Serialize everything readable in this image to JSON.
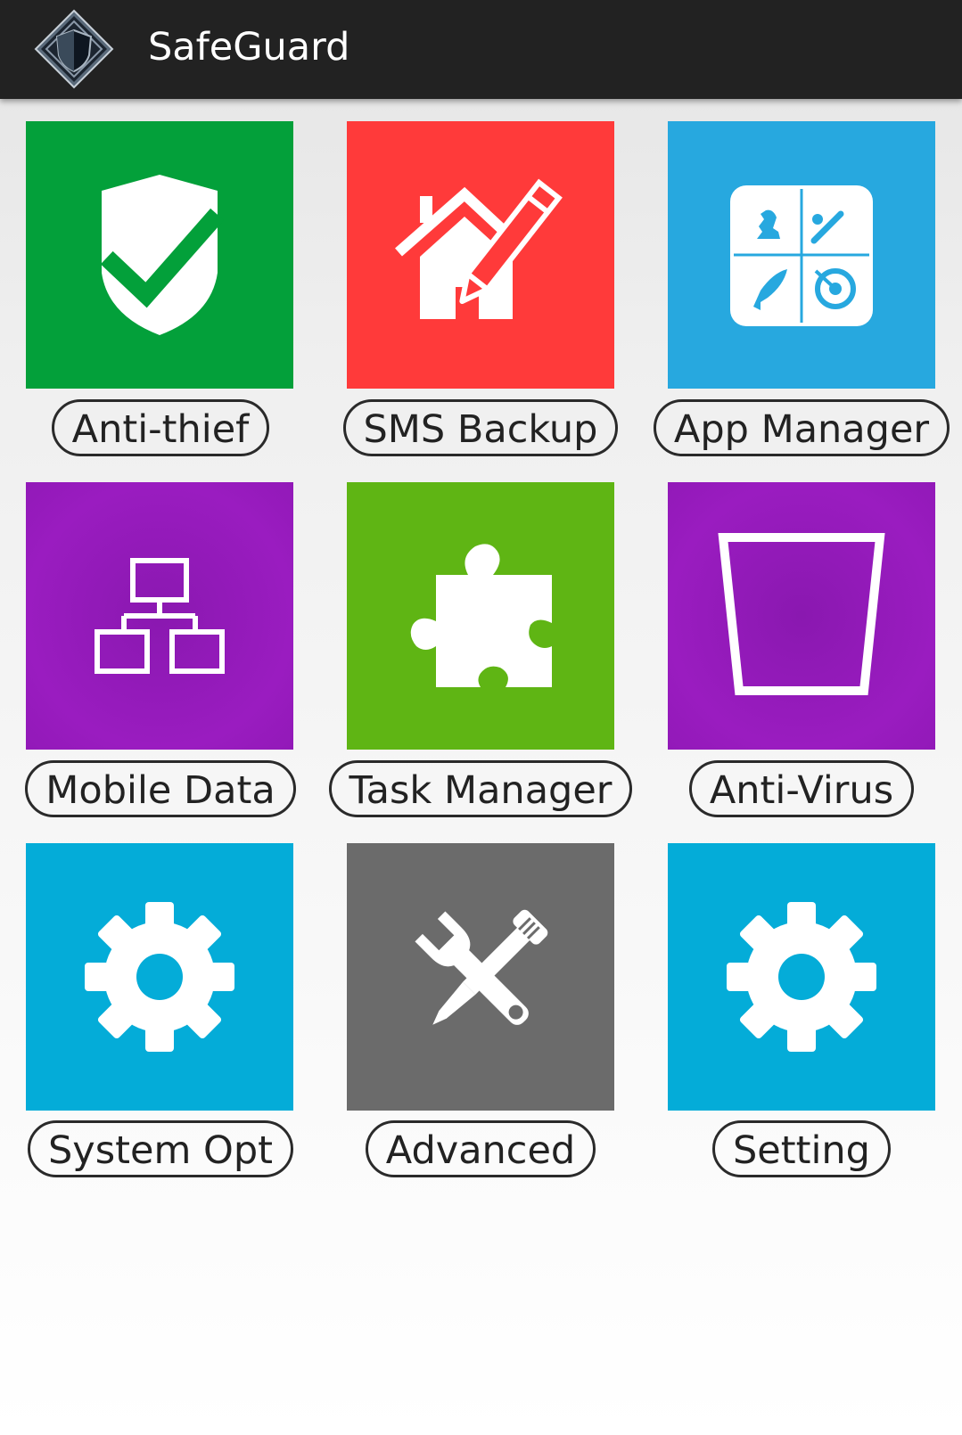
{
  "app_bar": {
    "title": "SafeGuard",
    "logo_icon": "shield-diamond-logo",
    "background": "#222222"
  },
  "tiles": [
    {
      "label": "Anti-thief",
      "icon": "shield-check-icon",
      "color": "#03a03a"
    },
    {
      "label": "SMS Backup",
      "icon": "house-pencil-icon",
      "color": "#ff3a3a"
    },
    {
      "label": "App Manager",
      "icon": "app-grid-icon",
      "color": "#27a8df"
    },
    {
      "label": "Mobile Data",
      "icon": "network-icon",
      "color": "#9219b8"
    },
    {
      "label": "Task Manager",
      "icon": "puzzle-piece-icon",
      "color": "#5fb514"
    },
    {
      "label": "Anti-Virus",
      "icon": "trash-bin-icon",
      "color": "#9219b8"
    },
    {
      "label": "System Opt",
      "icon": "gear-icon",
      "color": "#04acd8"
    },
    {
      "label": "Advanced",
      "icon": "wrench-screwdriver-icon",
      "color": "#6b6b6b"
    },
    {
      "label": "Setting",
      "icon": "gear-icon",
      "color": "#04acd8"
    }
  ]
}
